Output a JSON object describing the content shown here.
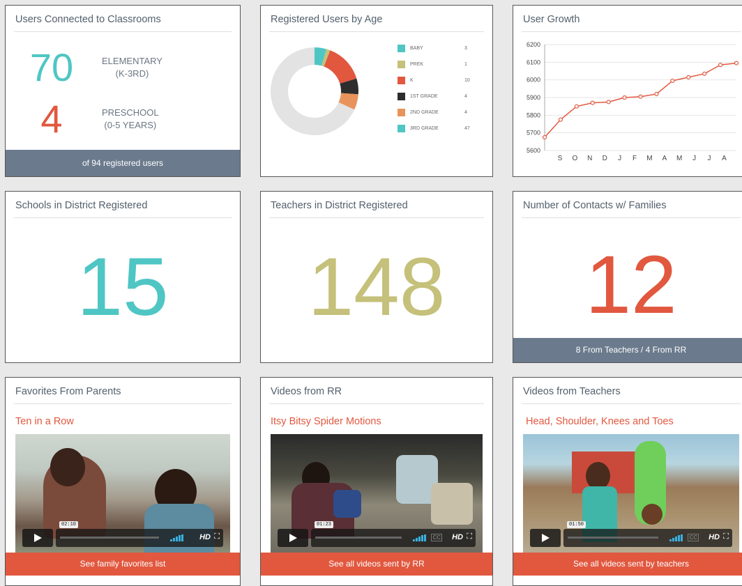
{
  "users_connected": {
    "title": "Users Connected to Classrooms",
    "elementary_count": "70",
    "elementary_label_1": "ELEMENTARY",
    "elementary_label_2": "(K-3RD)",
    "preschool_count": "4",
    "preschool_label_1": "PRESCHOOL",
    "preschool_label_2": "(0-5 YEARS)",
    "footer": "of 94 registered users"
  },
  "registered_by_age": {
    "title": "Registered Users by Age",
    "legend": [
      {
        "label": "BABY",
        "value": "3",
        "color": "#4fc6c4"
      },
      {
        "label": "PREK",
        "value": "1",
        "color": "#c5c07a"
      },
      {
        "label": "K",
        "value": "10",
        "color": "#e1583f"
      },
      {
        "label": "1ST GRADE",
        "value": "4",
        "color": "#2d2d2d"
      },
      {
        "label": "2ND GRADE",
        "value": "4",
        "color": "#e8935b"
      },
      {
        "label": "3RD GRADE",
        "value": "47",
        "color": "#4fc6c4"
      }
    ]
  },
  "user_growth": {
    "title": "User Growth"
  },
  "schools": {
    "title": "Schools in District Registered",
    "value": "15"
  },
  "teachers": {
    "title": "Teachers in District Registered",
    "value": "148"
  },
  "contacts": {
    "title": "Number of Contacts w/ Families",
    "value": "12",
    "footer": "8 From Teachers / 4 From RR"
  },
  "favorites": {
    "title": "Favorites From Parents",
    "video_title": "Ten in a Row",
    "time": "02:10",
    "footer": "See family favorites list"
  },
  "videos_rr": {
    "title": "Videos from RR",
    "video_title": "Itsy Bitsy Spider Motions",
    "time": "01:23",
    "footer": "See all videos sent by RR"
  },
  "videos_teachers": {
    "title": "Videos from Teachers",
    "video_title": "Head, Shoulder, Knees and Toes",
    "time": "01:50",
    "footer": "See all videos sent by teachers"
  },
  "video_controls": {
    "hd": "HD",
    "cc": "CC"
  },
  "colors": {
    "teal": "#4fc6c4",
    "olive": "#c5c07a",
    "orange": "#e1583f",
    "slate": "#6b7b8d"
  },
  "chart_data": [
    {
      "type": "pie",
      "title": "Registered Users by Age",
      "labels": [
        "BABY",
        "PREK",
        "K",
        "1ST GRADE",
        "2ND GRADE",
        "3RD GRADE"
      ],
      "values": [
        3,
        1,
        10,
        4,
        4,
        47
      ],
      "colors": [
        "#4fc6c4",
        "#c5c07a",
        "#e1583f",
        "#2d2d2d",
        "#e8935b",
        "#e3e3e3"
      ],
      "legend": "right"
    },
    {
      "type": "line",
      "title": "User Growth",
      "xlabel": "",
      "ylabel": "",
      "x_ticks": [
        "S",
        "O",
        "N",
        "D",
        "J",
        "F",
        "M",
        "A",
        "M",
        "J",
        "J",
        "A"
      ],
      "y_ticks": [
        5600,
        5700,
        5800,
        5900,
        6000,
        6100,
        6200
      ],
      "ylim": [
        5600,
        6200
      ],
      "grid": true,
      "values": [
        5675,
        5775,
        5850,
        5870,
        5875,
        5900,
        5905,
        5920,
        5995,
        6015,
        6035,
        6085,
        6095
      ],
      "color": "#e1583f"
    }
  ]
}
